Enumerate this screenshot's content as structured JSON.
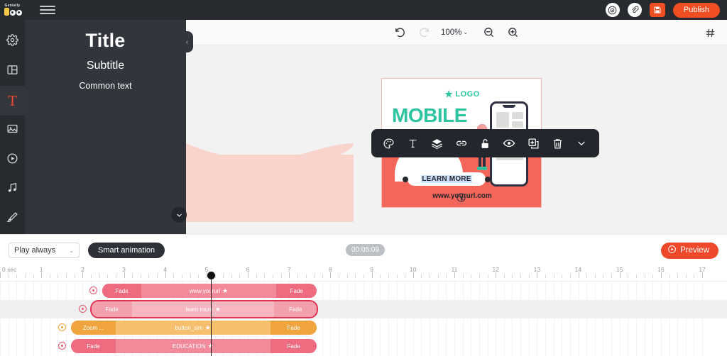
{
  "app": {
    "brand": "Genially",
    "menu_icon": "hamburger-icon"
  },
  "topbar": {
    "icons": [
      {
        "name": "record-icon",
        "glyph": "◉"
      },
      {
        "name": "attachment-icon",
        "glyph": "🔗"
      },
      {
        "name": "save-icon",
        "glyph": "💾"
      }
    ],
    "publish_label": "Publish"
  },
  "sidebar": {
    "items": [
      {
        "name": "sidebar-item-settings",
        "icon": "gear-icon",
        "active": false
      },
      {
        "name": "sidebar-item-layout",
        "icon": "layout-icon",
        "active": false
      },
      {
        "name": "sidebar-item-text",
        "icon": "text-icon",
        "label": "T",
        "active": true
      },
      {
        "name": "sidebar-item-image",
        "icon": "image-icon",
        "active": false
      },
      {
        "name": "sidebar-item-media",
        "icon": "play-circle-icon",
        "active": false
      },
      {
        "name": "sidebar-item-audio",
        "icon": "music-note-icon",
        "active": false
      },
      {
        "name": "sidebar-item-brush",
        "icon": "brush-icon",
        "active": false
      }
    ]
  },
  "text_panel": {
    "title": "Title",
    "subtitle": "Subtitle",
    "common": "Common text",
    "collapse_glyph": "‹"
  },
  "canvas_toolbar": {
    "undo": "undo-icon",
    "redo": "redo-icon",
    "zoom_value": "100%",
    "zoom_chevron": "⌄",
    "zoom_out": "zoom-out-icon",
    "zoom_in": "zoom-in-icon",
    "grid": "grid-icon"
  },
  "slide": {
    "logo_text": "LOGO",
    "headline": "MOBILE",
    "button_label": "LEARN MORE",
    "url": "www.yoururl.com"
  },
  "float_toolbar": {
    "items": [
      {
        "name": "palette-icon",
        "label": "palette"
      },
      {
        "name": "text-icon",
        "label": "text"
      },
      {
        "name": "layers-icon",
        "label": "layers"
      },
      {
        "name": "link-icon",
        "label": "link"
      },
      {
        "name": "unlock-icon",
        "label": "unlock"
      },
      {
        "name": "eye-icon",
        "label": "visibility"
      },
      {
        "name": "duplicate-icon",
        "label": "duplicate"
      },
      {
        "name": "trash-icon",
        "label": "delete"
      },
      {
        "name": "chevron-down-icon",
        "label": "more"
      }
    ]
  },
  "timeline_controls": {
    "play_mode": "Play always",
    "play_mode_chevron": "⌄",
    "smart_animation": "Smart animation",
    "time_code": "00:05:09",
    "preview_label": "Preview"
  },
  "ruler": {
    "first_label": "0 sec",
    "labels": [
      "1",
      "2",
      "3",
      "4",
      "5",
      "6",
      "7",
      "8",
      "9",
      "10",
      "11",
      "12",
      "13",
      "14",
      "15",
      "16",
      "17"
    ],
    "playhead_seconds": 5.1
  },
  "tracks": [
    {
      "name": "www.yoururl",
      "label": "www.yoururl",
      "in_effect": "Fade",
      "out_effect": "Fade",
      "color": "#ef6b7f",
      "mid_color": "#f28a9a",
      "selected": false,
      "eye": "visibility-icon",
      "start_pct": 14.1,
      "width_pct": 29.5
    },
    {
      "name": "learn more",
      "label": "learn more",
      "in_effect": "Fade",
      "out_effect": "Fade",
      "color": "#f3a0ad",
      "mid_color": "#f7b7c1",
      "selected": true,
      "eye": "visibility-icon",
      "start_pct": 12.6,
      "width_pct": 31.0
    },
    {
      "name": "button_sim",
      "label": "button_sim",
      "in_effect": "Zoom ...",
      "out_effect": "Fade",
      "color": "#efa43e",
      "mid_color": "#f5bf6e",
      "selected": false,
      "eye": "visibility-icon",
      "start_pct": 9.8,
      "width_pct": 33.8
    },
    {
      "name": "EDUCATION",
      "label": "EDUCATION",
      "in_effect": "Fade",
      "out_effect": "Fade",
      "color": "#ef6b7f",
      "mid_color": "#f28a9a",
      "selected": false,
      "eye": "visibility-icon",
      "start_pct": 9.8,
      "width_pct": 33.8
    }
  ],
  "colors": {
    "accent": "#f0482a",
    "dark": "#272a2f",
    "panel": "#32353b",
    "green": "#2ec4a0",
    "coral": "#f4665a"
  }
}
